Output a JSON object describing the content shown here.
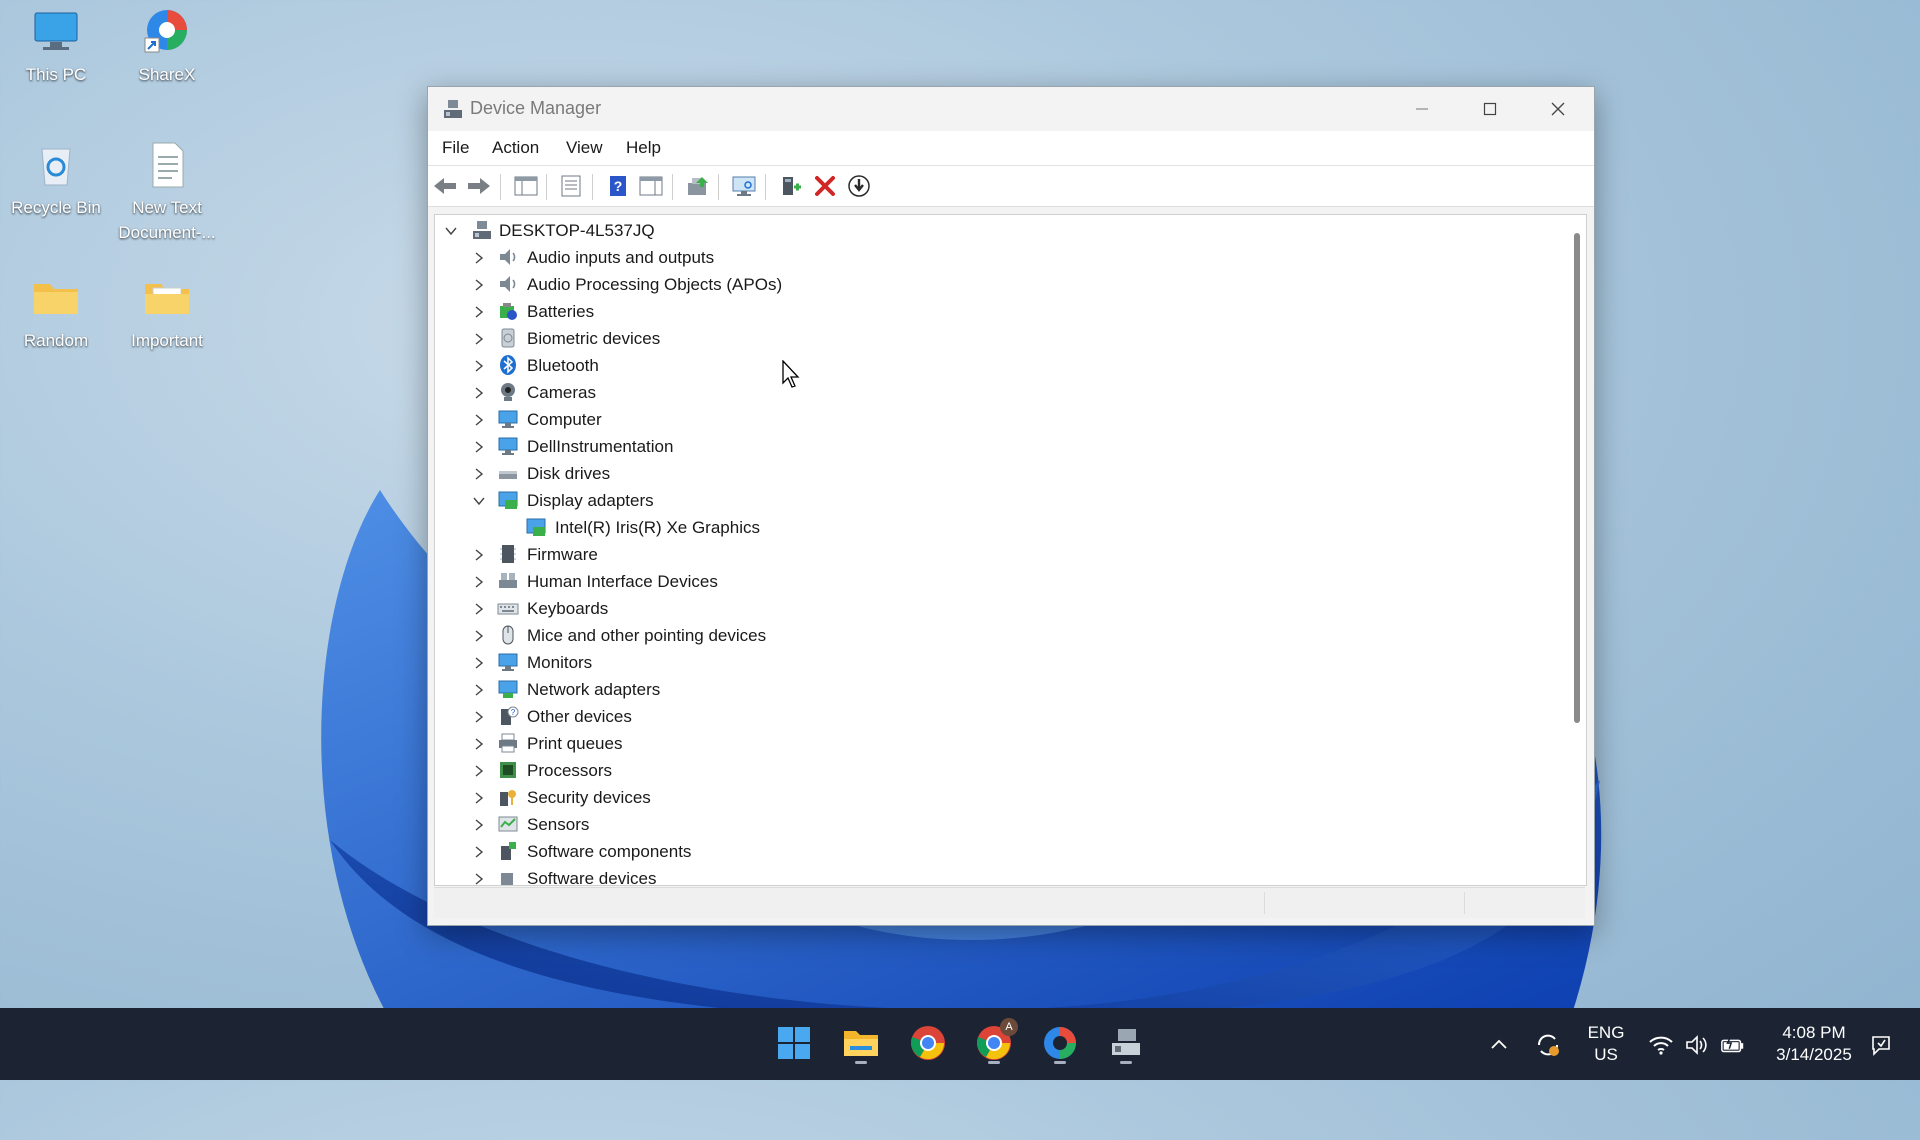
{
  "desktop": {
    "icons": [
      {
        "label": "This PC"
      },
      {
        "label": "ShareX"
      },
      {
        "label": "Recycle Bin"
      },
      {
        "label": "New Text Document-..."
      },
      {
        "label": "Random"
      },
      {
        "label": "Important"
      }
    ]
  },
  "window": {
    "title": "Device Manager",
    "menu": [
      "File",
      "Action",
      "View",
      "Help"
    ],
    "toolbar_icons": [
      "back-arrow-icon",
      "forward-arrow-icon",
      "show-hide-console-tree-icon",
      "properties-icon",
      "help-icon",
      "action-pane-icon",
      "update-driver-icon",
      "scan-hardware-icon",
      "add-legacy-hardware-icon",
      "uninstall-device-icon",
      "disable-device-icon"
    ],
    "tree": {
      "root": "DESKTOP-4L537JQ",
      "items": [
        {
          "label": "Audio inputs and outputs",
          "icon": "speaker-icon",
          "expanded": false
        },
        {
          "label": "Audio Processing Objects (APOs)",
          "icon": "speaker-icon",
          "expanded": false
        },
        {
          "label": "Batteries",
          "icon": "battery-icon",
          "expanded": false
        },
        {
          "label": "Biometric devices",
          "icon": "fingerprint-icon",
          "expanded": false
        },
        {
          "label": "Bluetooth",
          "icon": "bluetooth-icon",
          "expanded": false
        },
        {
          "label": "Cameras",
          "icon": "camera-icon",
          "expanded": false
        },
        {
          "label": "Computer",
          "icon": "monitor-icon",
          "expanded": false
        },
        {
          "label": "DellInstrumentation",
          "icon": "monitor-icon",
          "expanded": false
        },
        {
          "label": "Disk drives",
          "icon": "disk-drive-icon",
          "expanded": false
        },
        {
          "label": "Display adapters",
          "icon": "display-adapter-icon",
          "expanded": true,
          "children": [
            {
              "label": "Intel(R) Iris(R) Xe Graphics",
              "icon": "display-adapter-icon"
            }
          ]
        },
        {
          "label": "Firmware",
          "icon": "firmware-icon",
          "expanded": false
        },
        {
          "label": "Human Interface Devices",
          "icon": "hid-icon",
          "expanded": false
        },
        {
          "label": "Keyboards",
          "icon": "keyboard-icon",
          "expanded": false
        },
        {
          "label": "Mice and other pointing devices",
          "icon": "mouse-icon",
          "expanded": false
        },
        {
          "label": "Monitors",
          "icon": "monitor-icon",
          "expanded": false
        },
        {
          "label": "Network adapters",
          "icon": "network-adapter-icon",
          "expanded": false
        },
        {
          "label": "Other devices",
          "icon": "other-devices-icon",
          "expanded": false
        },
        {
          "label": "Print queues",
          "icon": "printer-icon",
          "expanded": false
        },
        {
          "label": "Processors",
          "icon": "processor-icon",
          "expanded": false
        },
        {
          "label": "Security devices",
          "icon": "security-device-icon",
          "expanded": false
        },
        {
          "label": "Sensors",
          "icon": "sensor-icon",
          "expanded": false
        },
        {
          "label": "Software components",
          "icon": "software-component-icon",
          "expanded": false
        },
        {
          "label": "Software devices",
          "icon": "software-device-icon",
          "expanded": false
        }
      ]
    }
  },
  "taskbar": {
    "apps": [
      "windows-start-icon",
      "file-explorer-icon",
      "chrome-icon",
      "chrome-profile-icon",
      "sharex-icon",
      "device-manager-icon"
    ],
    "chrome_profile_badge": "A",
    "language_line1": "ENG",
    "language_line2": "US",
    "time": "4:08 PM",
    "date": "3/14/2025"
  },
  "colors": {
    "accent_blue": "#1f6fd1",
    "taskbar_bg": "#1c2434",
    "uninstall_red": "#d12626"
  }
}
